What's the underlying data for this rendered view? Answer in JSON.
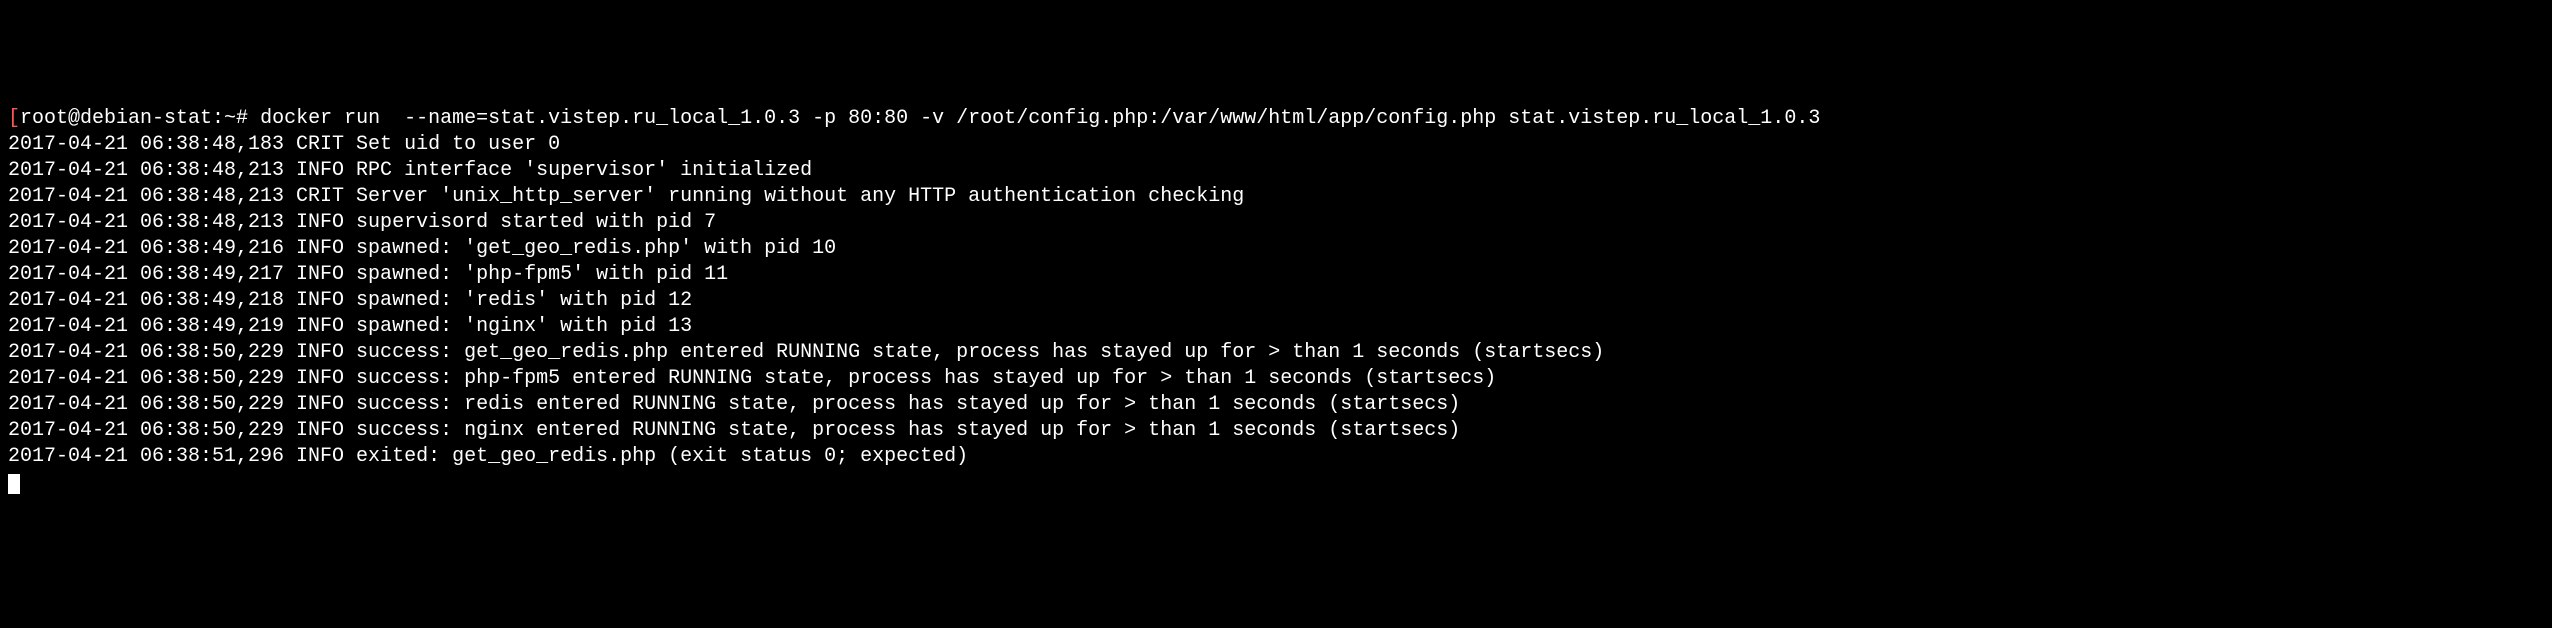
{
  "prompt": {
    "open_bracket": "[",
    "user_host": "root@debian-stat:~#",
    "command": " docker run  --name=stat.vistep.ru_local_1.0.3 -p 80:80 -v /root/config.php:/var/www/html/app/config.php stat.vistep.ru_local_1.0.3"
  },
  "log_lines": [
    "2017-04-21 06:38:48,183 CRIT Set uid to user 0",
    "2017-04-21 06:38:48,213 INFO RPC interface 'supervisor' initialized",
    "2017-04-21 06:38:48,213 CRIT Server 'unix_http_server' running without any HTTP authentication checking",
    "2017-04-21 06:38:48,213 INFO supervisord started with pid 7",
    "2017-04-21 06:38:49,216 INFO spawned: 'get_geo_redis.php' with pid 10",
    "2017-04-21 06:38:49,217 INFO spawned: 'php-fpm5' with pid 11",
    "2017-04-21 06:38:49,218 INFO spawned: 'redis' with pid 12",
    "2017-04-21 06:38:49,219 INFO spawned: 'nginx' with pid 13",
    "2017-04-21 06:38:50,229 INFO success: get_geo_redis.php entered RUNNING state, process has stayed up for > than 1 seconds (startsecs)",
    "2017-04-21 06:38:50,229 INFO success: php-fpm5 entered RUNNING state, process has stayed up for > than 1 seconds (startsecs)",
    "2017-04-21 06:38:50,229 INFO success: redis entered RUNNING state, process has stayed up for > than 1 seconds (startsecs)",
    "2017-04-21 06:38:50,229 INFO success: nginx entered RUNNING state, process has stayed up for > than 1 seconds (startsecs)",
    "2017-04-21 06:38:51,296 INFO exited: get_geo_redis.php (exit status 0; expected)"
  ]
}
